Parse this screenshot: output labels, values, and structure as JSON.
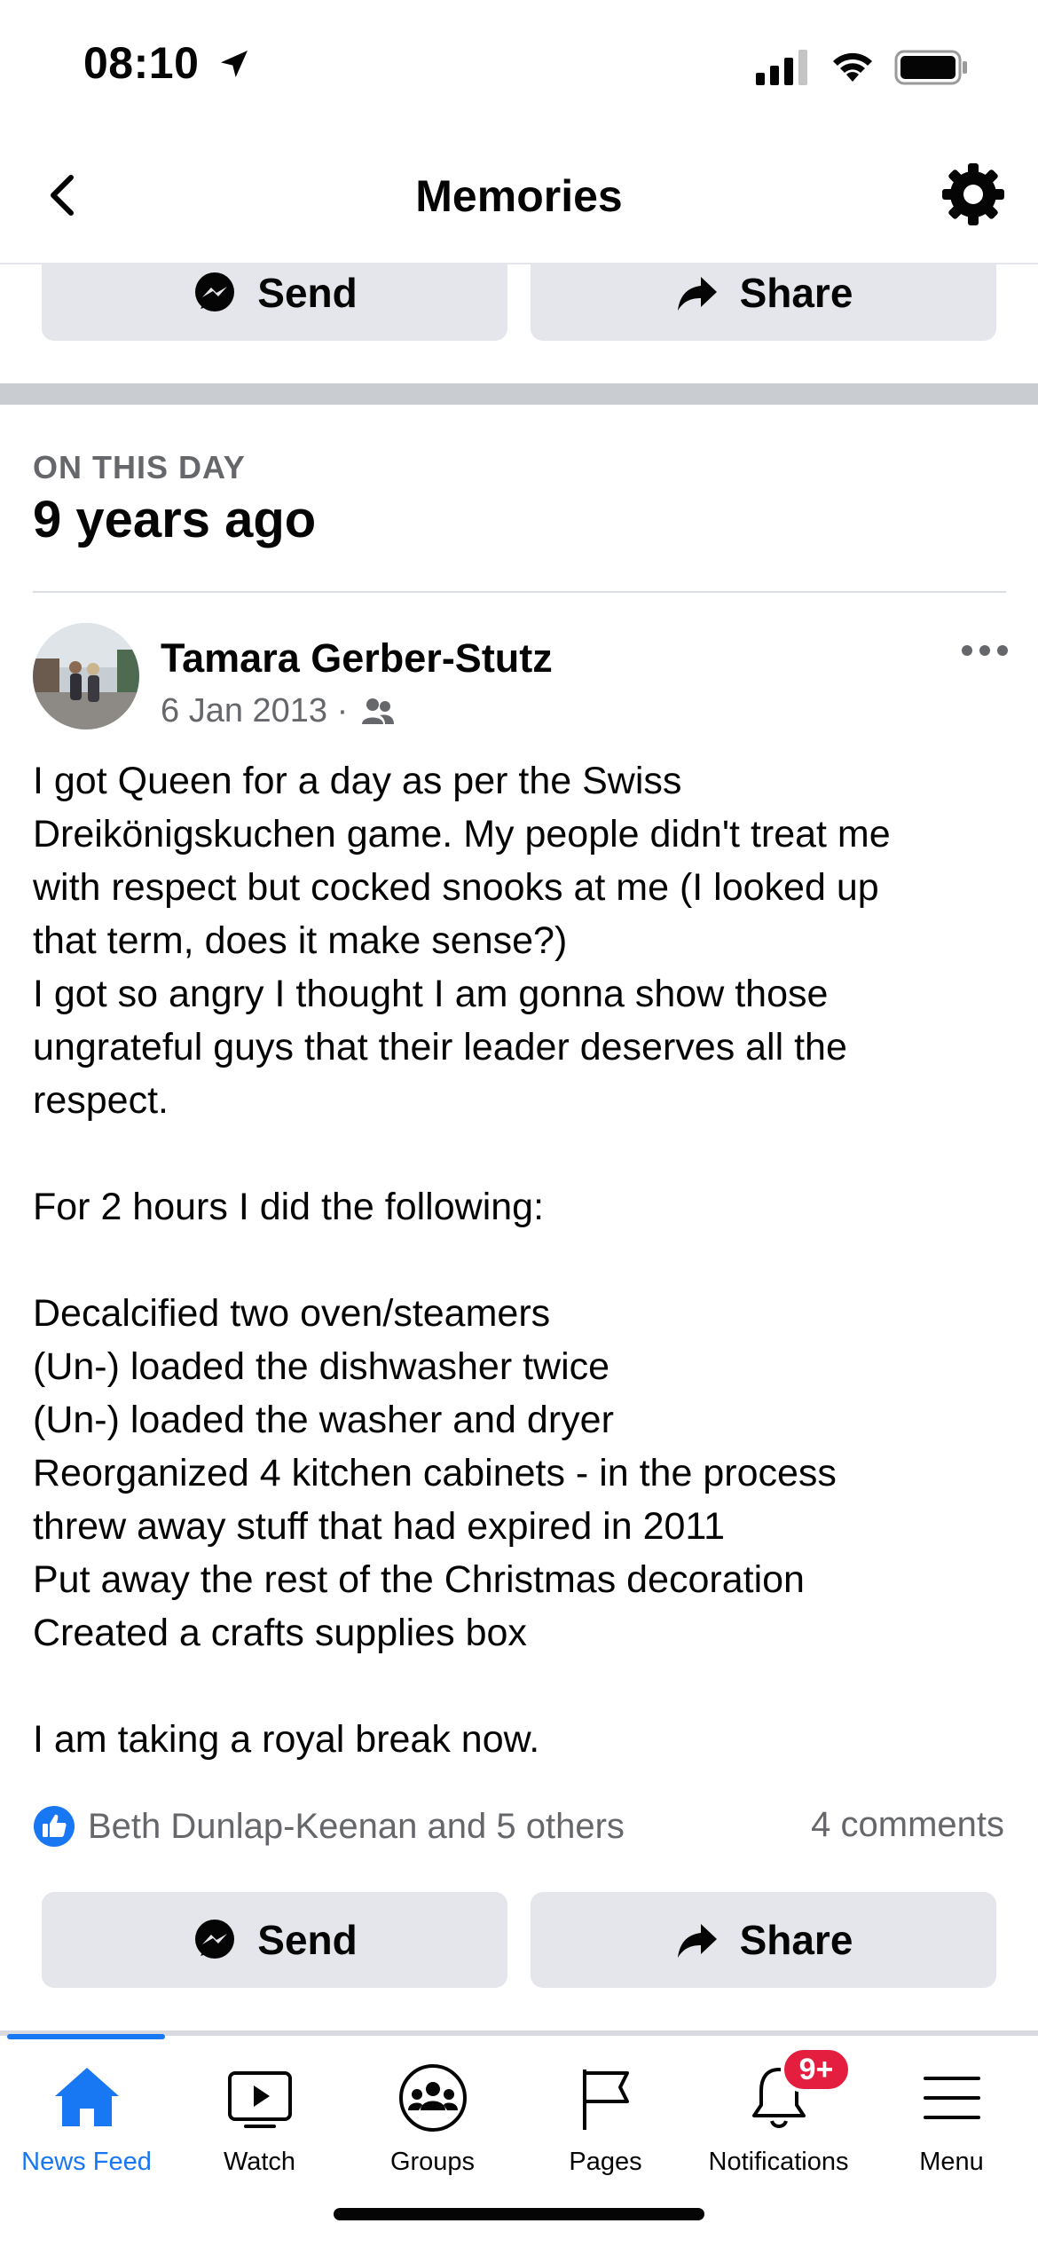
{
  "status_bar": {
    "time": "08:10"
  },
  "header": {
    "title": "Memories"
  },
  "top_actions": {
    "send_label": "Send",
    "share_label": "Share"
  },
  "memory": {
    "kicker": "ON THIS DAY",
    "title": "9 years ago"
  },
  "post": {
    "author": "Tamara Gerber-Stutz",
    "date": "6 Jan 2013 ·",
    "audience_icon": "friends-icon",
    "body_lines": [
      "I got Queen for a day as per the Swiss",
      "Dreikönigskuchen game. My people didn't treat me",
      "with respect but cocked snooks at me (I looked up",
      "that term, does it make sense?)",
      "I got so angry I thought I am gonna show those",
      "ungrateful guys that their leader deserves all the",
      "respect.",
      "",
      "For 2 hours I did the following:",
      "",
      "Decalcified two oven/steamers",
      "(Un-) loaded the dishwasher twice",
      "(Un-) loaded the washer and dryer",
      "Reorganized 4 kitchen cabinets - in the process",
      "threw away stuff that had expired in 2011",
      "Put away the rest of the Christmas decoration",
      "Created a crafts supplies box",
      "",
      "I am taking a royal break now."
    ],
    "reactions_text": "Beth Dunlap-Keenan and 5 others",
    "comments_text": "4 comments",
    "send_label": "Send",
    "share_label": "Share"
  },
  "bottom_nav": {
    "items": [
      {
        "label": "News Feed",
        "icon": "home-icon",
        "active": true
      },
      {
        "label": "Watch",
        "icon": "video-icon",
        "active": false
      },
      {
        "label": "Groups",
        "icon": "groups-icon",
        "active": false
      },
      {
        "label": "Pages",
        "icon": "flag-icon",
        "active": false
      },
      {
        "label": "Notifications",
        "icon": "bell-icon",
        "active": false
      },
      {
        "label": "Menu",
        "icon": "hamburger-icon",
        "active": false
      }
    ],
    "notifications_badge": "9+"
  },
  "colors": {
    "accent": "#1877f2",
    "button_bg": "#e4e6eb",
    "secondary_text": "#65676b",
    "badge": "#e41e3f"
  }
}
